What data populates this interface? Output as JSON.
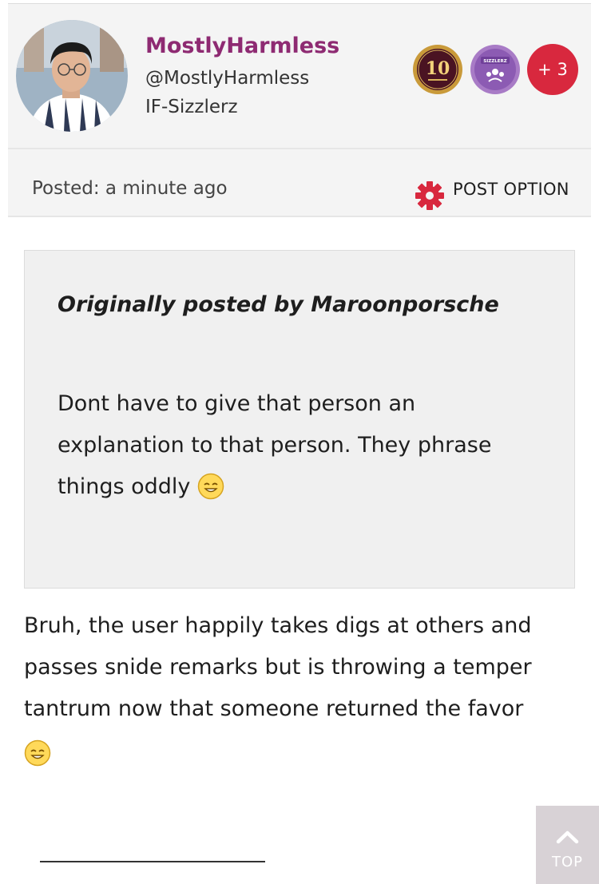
{
  "post": {
    "author": {
      "username": "MostlyHarmless",
      "handle": "@MostlyHarmless",
      "club": "IF-Sizzlerz",
      "badges": [
        {
          "name": "10-year-badge",
          "label": "10"
        },
        {
          "name": "sizzlerz-badge",
          "label": "SIZZLERZ"
        }
      ],
      "more_badges": "+ 3"
    },
    "posted": "Posted: a minute ago",
    "post_option_label": "POST OPTION",
    "quote": {
      "header": "Originally posted by Maroonporsche",
      "text": "Dont have to give that person an explanation to that person. They phrase things oddly"
    },
    "body": "Bruh, the user happily takes digs at others and passes snide remarks but is throwing a temper tantrum now that someone returned the favor"
  },
  "top_button": {
    "label": "TOP"
  },
  "colors": {
    "username": "#8e2a72",
    "gear": "#d8283e",
    "more_badge": "#d8283e",
    "header_bg": "#f4f4f4",
    "quote_bg": "#f0f0f0",
    "top_button_bg": "#d8d2d6"
  }
}
